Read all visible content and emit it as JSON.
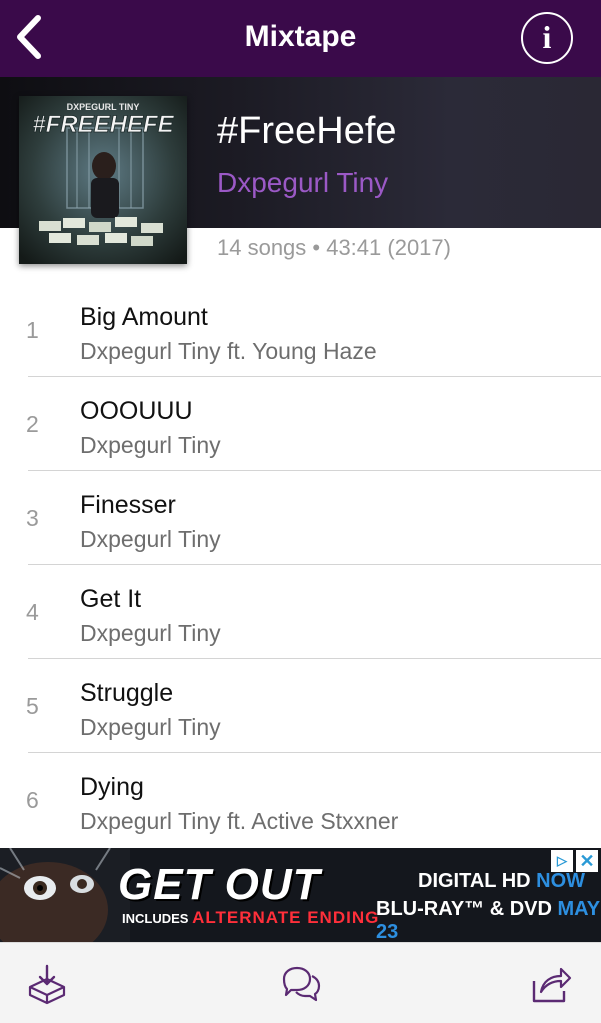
{
  "navbar": {
    "title": "Mixtape",
    "back_icon": "chevron-left-icon",
    "info_icon": "info-icon",
    "info_glyph": "i"
  },
  "album": {
    "title": "#FreeHefe",
    "artist": "Dxpegurl Tiny",
    "meta": "14 songs • 43:41 (2017)",
    "cover": {
      "title_text": "#FREEHEFE",
      "artist_text": "DXPEGURL TINY"
    }
  },
  "tracks": [
    {
      "number": "1",
      "title": "Big Amount",
      "artist": "Dxpegurl Tiny ft. Young Haze"
    },
    {
      "number": "2",
      "title": "OOOUUU",
      "artist": "Dxpegurl Tiny"
    },
    {
      "number": "3",
      "title": "Finesser",
      "artist": "Dxpegurl Tiny"
    },
    {
      "number": "4",
      "title": "Get It",
      "artist": "Dxpegurl Tiny"
    },
    {
      "number": "5",
      "title": "Struggle",
      "artist": "Dxpegurl Tiny"
    },
    {
      "number": "6",
      "title": "Dying",
      "artist": "Dxpegurl Tiny ft. Active Stxxner"
    }
  ],
  "ad": {
    "headline": "GET OUT",
    "sub_prefix": "INCLUDES",
    "sub_accent": "ALTERNATE ENDING",
    "line1_white": "DIGITAL HD",
    "line1_blue": "NOW",
    "line2_white": "BLU-RAY™ & DVD",
    "line2_blue": "MAY 23",
    "close_glyph": "✕",
    "choice_glyph": "▷"
  },
  "toolbar": {
    "download_icon": "download-icon",
    "comments_icon": "comments-icon",
    "share_icon": "share-icon"
  },
  "colors": {
    "nav_bg": "#3a0a4a",
    "accent_purple": "#9b59c6",
    "ad_blue": "#2d8fe0",
    "ad_red": "#ff2f3a"
  }
}
